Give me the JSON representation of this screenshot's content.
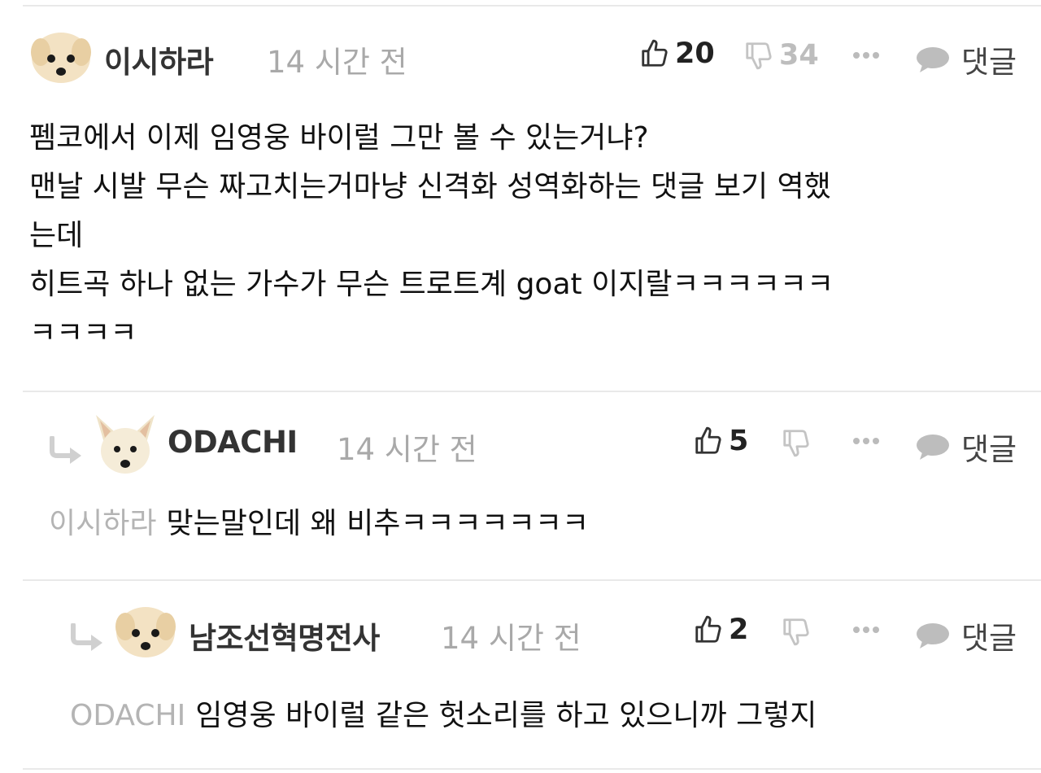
{
  "comments": [
    {
      "username": "이시하라",
      "time": "14 시간 전",
      "likes": "20",
      "dislikes": "34",
      "reply_label": "댓글",
      "avatar": "puppy-face-icon",
      "lines": [
        "펨코에서 이제 임영웅 바이럴 그만 볼 수 있는거냐?",
        "맨날 시발 무슨 짜고치는거마냥 신격화 성역화하는 댓글 보기 역했",
        "는데",
        "히트곡 하나 없는 가수가 무슨 트로트계 goat 이지랄ㅋㅋㅋㅋㅋㅋ",
        "ㅋㅋㅋㅋ"
      ]
    },
    {
      "username": "ODACHI",
      "time": "14 시간 전",
      "likes": "5",
      "dislikes": "",
      "reply_label": "댓글",
      "avatar": "dog-face-icon",
      "mention": "이시하라",
      "text": "맞는말인데 왜 비추ㅋㅋㅋㅋㅋㅋㅋ"
    },
    {
      "username": "남조선혁명전사",
      "time": "14 시간 전",
      "likes": "2",
      "dislikes": "",
      "reply_label": "댓글",
      "avatar": "puppy-face-icon",
      "mention": "ODACHI",
      "text": "임영웅 바이럴 같은 헛소리를 하고 있으니까 그렇지"
    }
  ],
  "colors": {
    "username": "#333333",
    "meta": "#a9a9a9",
    "mention": "#b4b4b4",
    "divider": "#e9e9e9",
    "icon": "#444444",
    "icon_light": "#c4c4c4"
  }
}
